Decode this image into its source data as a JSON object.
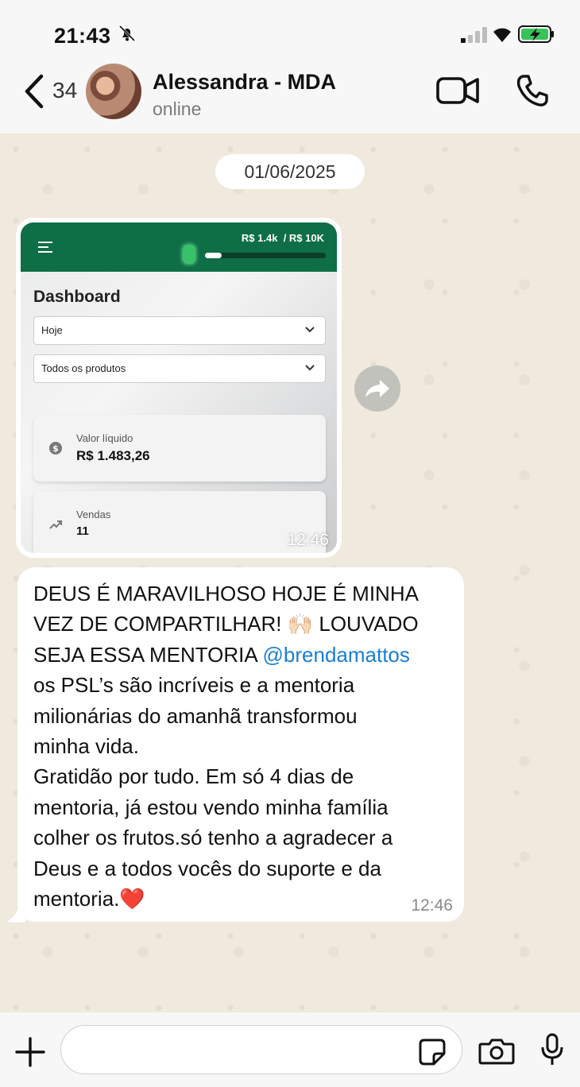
{
  "status_bar": {
    "time": "21:43",
    "icons": [
      "bell-off-icon",
      "signal-icon",
      "wifi-icon",
      "battery-charging-icon"
    ]
  },
  "header": {
    "back_count": "34",
    "contact_name": "Alessandra - MDA",
    "contact_status": "online",
    "icons": [
      "back-chevron-icon",
      "video-call-icon",
      "phone-call-icon"
    ]
  },
  "chat": {
    "date": "01/06/2025",
    "image_message": {
      "time": "12:46",
      "screenshot": {
        "progress_current": "R$ 1.4k",
        "progress_target": "/ R$ 10K",
        "progress_fraction": 0.14,
        "title": "Dashboard",
        "select_period": "Hoje",
        "select_products": "Todos os produtos",
        "card_net_label": "Valor líquido",
        "card_net_value": "R$ 1.483,26",
        "card_sales_label": "Vendas",
        "card_sales_value": "11"
      }
    },
    "text_message": {
      "part1": "DEUS É MARAVILHOSO HOJE É MINHA\nVEZ DE COMPARTILHAR! 🙌🏻 LOUVADO\nSEJA ESSA MENTORIA ",
      "mention": "@brendamattos",
      "part2": "\nos PSL’s são incríveis e a mentoria\nmilionárias do amanhã transformou\nminha vida.\nGratidão por tudo. Em só 4 dias de\nmentoria, já estou vendo minha família\ncolher os frutos.só tenho a agradecer a\nDeus e a todos vocês do suporte e da\nmentoria.❤️",
      "time": "12:46"
    }
  },
  "input_bar": {
    "placeholder": "",
    "icons": [
      "plus-icon",
      "sticker-icon",
      "camera-icon",
      "microphone-icon"
    ]
  },
  "colors": {
    "accent_green": "#0e6e46",
    "mention_blue": "#1a7fd1",
    "chat_background": "#efe9de"
  }
}
